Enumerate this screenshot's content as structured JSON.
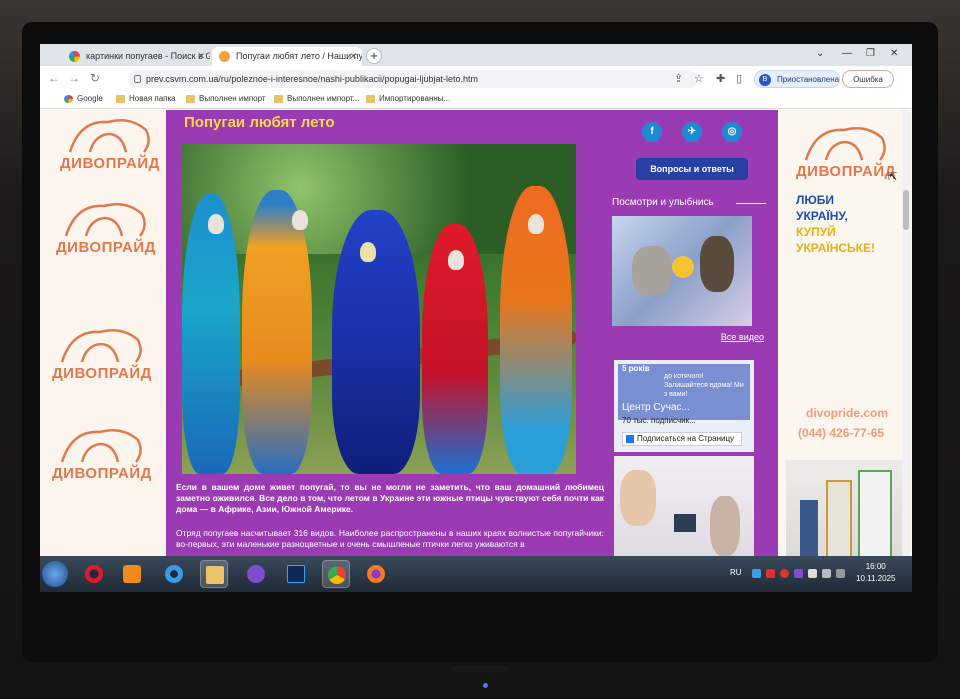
{
  "browser": {
    "tabs": [
      {
        "title": "картинки попугаев - Поиск в Google"
      },
      {
        "title": "Попугаи любят лето / Наши публикации"
      }
    ],
    "url": "prev.csvm.com.ua/ru/poleznoe-i-interesnoe/nashi-publikacii/popugai-ljubjat-leto.htm",
    "profile_label": "Приостановлена",
    "profile_initial": "B",
    "error_label": "Ошибка",
    "bookmarks": [
      "Google",
      "Новая папка",
      "Выполнен импорт",
      "Выполнен импорт...",
      "Импортированны..."
    ]
  },
  "page": {
    "title": "Попугаи любят лето",
    "para1": "Если в вашем доме живет попугай, то вы не могли не заметить, что ваш домашний любимец заметно оживился. Все дело в том, что летом в Украине эти южные птицы чувствуют себя почти как дома — в Африке, Азии, Южной Америке.",
    "para2": "Отряд попугаев насчитывает 316 видов. Наиболее распространены в наших краях волнистые попугайчики: во-первых, эти маленькие разноцветные и очень смышленые птички легко уживаются в",
    "logo_text": "ДИВОПРАЙД",
    "sidebar": {
      "faq": "Вопросы и ответы",
      "look_title": "Посмотри и улыбнись",
      "all_videos": "Все видео",
      "fb_years": "5 років",
      "fb_name": "Центр Сучас...",
      "fb_sub": "70 тыс. подписчик...",
      "fb_like": "Подписаться на Страницу",
      "fb_banner": "до котячого! Залишайтеся вдома! Ми з вами!",
      "social": [
        "f",
        "✈",
        "◎"
      ]
    },
    "right": {
      "slogan": [
        "ЛЮБИ",
        "УКРАЇНУ,",
        "КУПУЙ",
        "УКРАЇНСЬКЕ!"
      ],
      "site": "divopride.com",
      "phone": "(044) 426-77-65"
    }
  },
  "taskbar": {
    "lang": "RU",
    "time": "16:00",
    "date": "10.11.2025"
  },
  "colors": {
    "content_bg": "#9b3bb4",
    "title": "#ffd84a",
    "brand": "#e07a4c",
    "faq": "#283fa6"
  }
}
